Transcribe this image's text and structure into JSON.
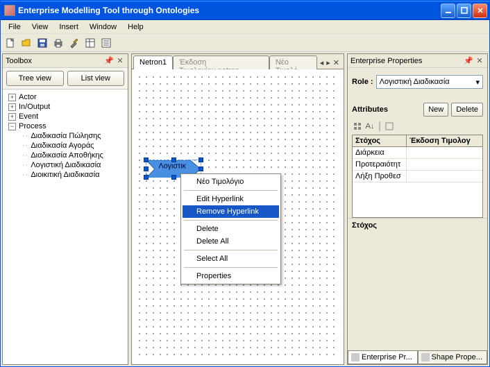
{
  "title": "Enterprise Modelling Tool through Ontologies",
  "menubar": [
    "File",
    "View",
    "Insert",
    "Window",
    "Help"
  ],
  "toolbar_icons": [
    "new-icon",
    "open-icon",
    "save-icon",
    "print-icon",
    "tools-icon",
    "props-icon",
    "list-icon"
  ],
  "toolbox": {
    "title": "Toolbox",
    "btn_tree": "Tree view",
    "btn_list": "List view",
    "nodes": [
      {
        "label": "Actor",
        "expanded": false
      },
      {
        "label": "In/Output",
        "expanded": false
      },
      {
        "label": "Event",
        "expanded": false
      },
      {
        "label": "Process",
        "expanded": true,
        "children": [
          "Διαδικασία Πώλησης",
          "Διαδικασία Αγοράς",
          "Διαδικασία Αποθήκης",
          "Λογιστική Διαδικασία",
          "Διοικιτική Διαδικασία"
        ]
      }
    ]
  },
  "tabs": {
    "items": [
      "Netron1",
      "Έκδοση Τιμολογίου.netron",
      "Νέο Τιμολό"
    ],
    "active_index": 0
  },
  "shape": {
    "label": "Λογιστικ"
  },
  "context_menu": [
    {
      "label": "Νέο Τιμολόγιο",
      "sep_after": true
    },
    {
      "label": "Edit Hyperlink"
    },
    {
      "label": "Remove Hyperlink",
      "highlight": true,
      "sep_after": true
    },
    {
      "label": "Delete"
    },
    {
      "label": "Delete All",
      "sep_after": true
    },
    {
      "label": "Select All",
      "sep_after": true
    },
    {
      "label": "Properties"
    }
  ],
  "props": {
    "title": "Enterprise Properties",
    "role_label": "Role :",
    "role_value": "Λογιστική Διαδικασία",
    "attributes_label": "Attributes",
    "btn_new": "New",
    "btn_delete": "Delete",
    "table_head": [
      "Στόχος",
      "Έκδοση Τιμολογ"
    ],
    "rows": [
      "Διάρκεια",
      "Προτεραιότητ",
      "Λήξη Προθεσ"
    ],
    "section": "Στόχος",
    "bottom_tabs": [
      "Enterprise Pr...",
      "Shape Prope..."
    ]
  }
}
